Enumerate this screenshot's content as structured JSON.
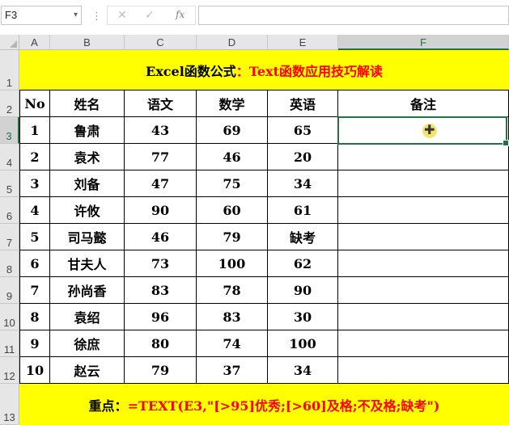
{
  "formula_bar": {
    "name_box": "F3",
    "cancel_icon": "✕",
    "enter_icon": "✓",
    "fx_label": "fx",
    "formula": ""
  },
  "sheet": {
    "columns": [
      "A",
      "B",
      "C",
      "D",
      "E",
      "F"
    ],
    "rows": [
      "1",
      "2",
      "3",
      "4",
      "5",
      "6",
      "7",
      "8",
      "9",
      "10",
      "11",
      "12",
      "13"
    ],
    "selected_cell": "F3",
    "title_black": "Excel函数公式",
    "title_red": "：Text函数应用技巧解读",
    "headers": [
      "No",
      "姓名",
      "语文",
      "数学",
      "英语",
      "备注"
    ],
    "data_rows": [
      [
        "1",
        "鲁肃",
        "43",
        "69",
        "65",
        ""
      ],
      [
        "2",
        "袁术",
        "77",
        "46",
        "20",
        ""
      ],
      [
        "3",
        "刘备",
        "47",
        "75",
        "34",
        ""
      ],
      [
        "4",
        "许攸",
        "90",
        "60",
        "61",
        ""
      ],
      [
        "5",
        "司马懿",
        "46",
        "79",
        "缺考",
        ""
      ],
      [
        "6",
        "甘夫人",
        "73",
        "100",
        "62",
        ""
      ],
      [
        "7",
        "孙尚香",
        "83",
        "78",
        "90",
        ""
      ],
      [
        "8",
        "袁绍",
        "96",
        "83",
        "30",
        ""
      ],
      [
        "9",
        "徐庶",
        "80",
        "74",
        "100",
        ""
      ],
      [
        "10",
        "赵云",
        "79",
        "37",
        "34",
        ""
      ]
    ],
    "footer_black": "重点：",
    "footer_red": "=TEXT(E3,\"[>95]优秀;[>60]及格;不及格;缺考\")"
  },
  "colors": {
    "highlight": "#ffff00",
    "accent_red": "#ff0000",
    "selection": "#217346"
  }
}
